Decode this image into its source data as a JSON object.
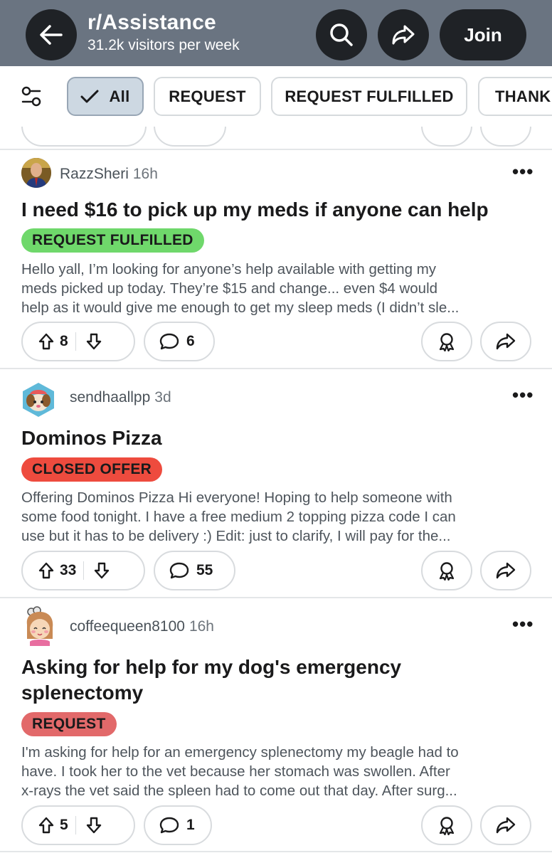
{
  "header": {
    "subreddit": "r/Assistance",
    "visitors": "31.2k visitors per week",
    "join_label": "Join",
    "background_color": "#6a7481"
  },
  "filters": {
    "chips": [
      "All",
      "REQUEST",
      "REQUEST FULFILLED",
      "THANK"
    ],
    "selected": "All"
  },
  "posts": [
    {
      "author": "RazzSheri",
      "age": "16h",
      "title": "I need $16 to pick up my meds if anyone can help",
      "flair": "REQUEST FULFILLED",
      "flair_color": "#6fd86b",
      "body_lines": [
        "Hello yall, I’m looking for anyone’s help available with getting my",
        "meds picked up today. They’re $15 and change... even $4 would",
        "help as it would give me enough to get my sleep meds (I didn’t sle..."
      ],
      "votes": "8",
      "comments": "6"
    },
    {
      "author": "sendhaallpp",
      "age": "3d",
      "title": "Dominos Pizza",
      "flair": "CLOSED OFFER",
      "flair_color": "#ee4b3e",
      "body_lines": [
        "Offering Dominos Pizza Hi everyone! Hoping to help someone with",
        "some food tonight. I have a free medium 2 topping pizza code I can",
        "use but it has to be delivery :) Edit: just to clarify, I will pay for the..."
      ],
      "votes": "33",
      "comments": "55"
    },
    {
      "author": "coffeequeen8100",
      "age": "16h",
      "title_lines": [
        "Asking for help for my dog's emergency",
        "splenectomy"
      ],
      "flair": "REQUEST",
      "flair_color": "#e2696a",
      "body_lines": [
        "I'm asking for help for an emergency splenectomy my beagle had to",
        "have. I took her to the vet because her stomach was swollen. After",
        "x-rays the vet said the spleen had to come out that day. After surg..."
      ],
      "votes": "5",
      "comments": "1"
    }
  ]
}
